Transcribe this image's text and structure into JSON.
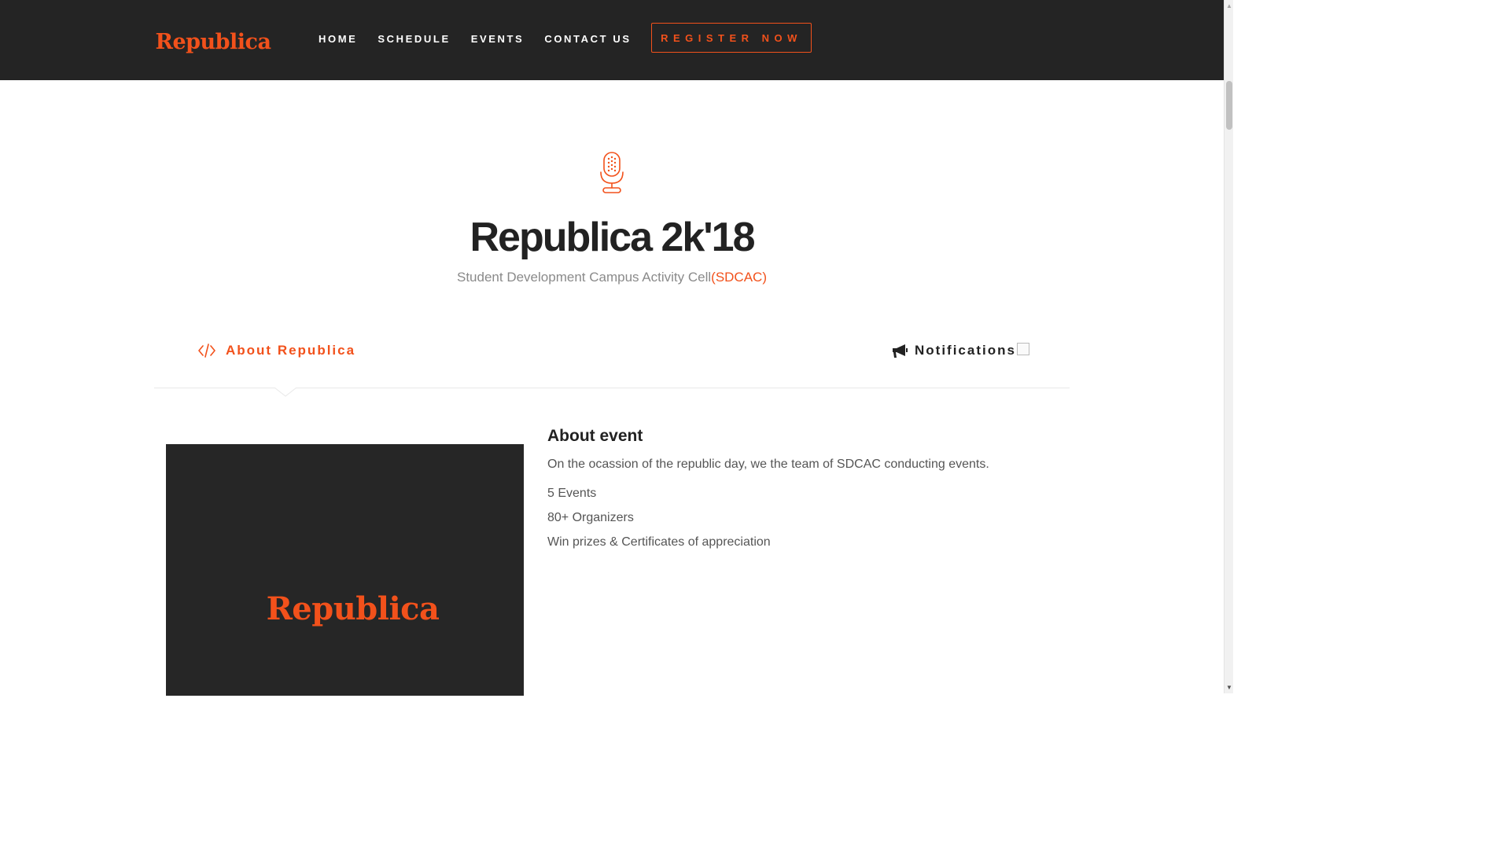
{
  "brand": {
    "logo_text": "Republica",
    "accent_color": "#f2511b",
    "dark_color": "#242424"
  },
  "nav": {
    "items": [
      {
        "label": "HOME"
      },
      {
        "label": "SCHEDULE"
      },
      {
        "label": "EVENTS"
      },
      {
        "label": "CONTACT US"
      }
    ],
    "register_label": "REGISTER NOW"
  },
  "hero": {
    "icon": "microphone-icon",
    "title": "Republica 2k'18",
    "subtitle": "Student Development Campus Activity Cell",
    "subtitle_accent": "(SDCAC)"
  },
  "tabs": {
    "about": {
      "icon": "code-icon",
      "label": "About Republica"
    },
    "notifications": {
      "icon": "megaphone-icon",
      "label": "Notifications"
    }
  },
  "about": {
    "poster_text": "Republica",
    "heading": "About event",
    "description": "On the ocassion of the republic day, we the team of SDCAC conducting events.",
    "facts": [
      "5 Events",
      "80+ Organizers",
      "Win prizes & Certificates of appreciation"
    ]
  }
}
